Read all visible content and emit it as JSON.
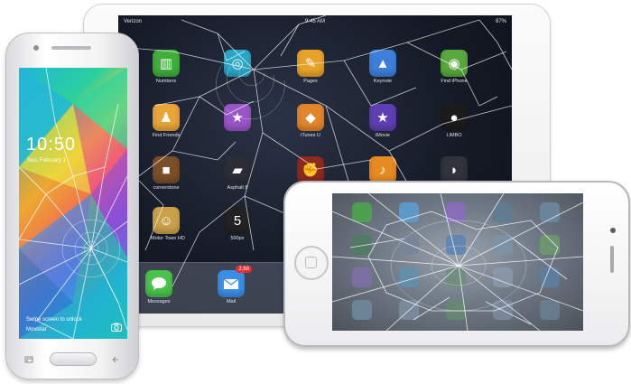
{
  "tablet": {
    "status_carrier": "Verizon",
    "status_time": "9:45 AM",
    "status_battery": "87%",
    "apps": [
      {
        "label": "Numbers",
        "color": "#3fae3a",
        "icon": "chart-icon"
      },
      {
        "label": "",
        "color": "#2aa6c7",
        "icon": "photo-icon"
      },
      {
        "label": "Pages",
        "color": "#e7a229",
        "icon": "pen-icon"
      },
      {
        "label": "Keynote",
        "color": "#3d7fd8",
        "icon": "podium-icon"
      },
      {
        "label": "Find iPhone",
        "color": "#58a83d",
        "icon": "radar-icon"
      },
      {
        "label": "Find Friends",
        "color": "#e9a43a",
        "icon": "people-icon"
      },
      {
        "label": "",
        "color": "#9a55c9",
        "icon": "star-icon"
      },
      {
        "label": "iTunes U",
        "color": "#e2852c",
        "icon": "graduation-icon"
      },
      {
        "label": "iMovie",
        "color": "#5e3fb3",
        "icon": "star-icon"
      },
      {
        "label": "LIMBO",
        "color": "#1b1b1b",
        "icon": "boy-icon"
      },
      {
        "label": "cornerstone",
        "color": "#7a4e28",
        "icon": "cornerstone-icon"
      },
      {
        "label": "Asphalt 8",
        "color": "#2b2e35",
        "icon": "car-icon"
      },
      {
        "label": "",
        "color": "#8c2a1e",
        "icon": "fist-icon"
      },
      {
        "label": "",
        "color": "#e68a22",
        "icon": "guitar-icon"
      },
      {
        "label": "",
        "color": "#30343a",
        "icon": "batman-icon"
      },
      {
        "label": "Motor Town HD",
        "color": "#c9a14a",
        "icon": "character-icon"
      },
      {
        "label": "500px",
        "color": "#222222",
        "icon": "500px-icon"
      }
    ],
    "dock": [
      {
        "label": "Messages",
        "color": "#4bc24b",
        "icon": "speech-bubble-icon"
      },
      {
        "label": "Mail",
        "color": "#3b8ee6",
        "icon": "envelope-icon",
        "badge": "2,68"
      }
    ]
  },
  "android": {
    "time": "10:50",
    "date": "Sun, February 1",
    "swipe_text": "Swipe screen to unlock",
    "carrier": "Movistar"
  }
}
